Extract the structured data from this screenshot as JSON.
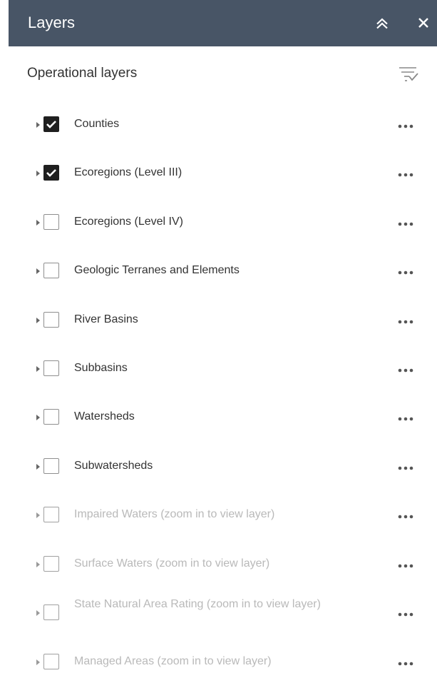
{
  "panel": {
    "title": "Layers",
    "section_title": "Operational layers",
    "colors": {
      "header_bg": "#485566",
      "header_text": "#ffffff",
      "text": "#333333",
      "dim_text": "#b9b9b9",
      "checkbox_checked": "#1f1f1f"
    },
    "icons": {
      "collapse": "double-chevron-up-icon",
      "close": "close-icon",
      "filter": "filter-list-check-icon",
      "expand": "caret-right-icon",
      "more": "ellipsis-icon"
    }
  },
  "layers": [
    {
      "label": "Counties",
      "checked": true,
      "dimmed": false
    },
    {
      "label": "Ecoregions (Level III)",
      "checked": true,
      "dimmed": false
    },
    {
      "label": "Ecoregions (Level IV)",
      "checked": false,
      "dimmed": false
    },
    {
      "label": "Geologic Terranes and Elements",
      "checked": false,
      "dimmed": false
    },
    {
      "label": "River Basins",
      "checked": false,
      "dimmed": false
    },
    {
      "label": "Subbasins",
      "checked": false,
      "dimmed": false
    },
    {
      "label": "Watersheds",
      "checked": false,
      "dimmed": false
    },
    {
      "label": "Subwatersheds",
      "checked": false,
      "dimmed": false
    },
    {
      "label": "Impaired Waters (zoom in to view layer)",
      "checked": false,
      "dimmed": true
    },
    {
      "label": "Surface Waters (zoom in to view layer)",
      "checked": false,
      "dimmed": true
    },
    {
      "label": "State Natural Area Rating (zoom in to view layer)",
      "checked": false,
      "dimmed": true
    },
    {
      "label": "Managed Areas (zoom in to view layer)",
      "checked": false,
      "dimmed": true
    }
  ]
}
